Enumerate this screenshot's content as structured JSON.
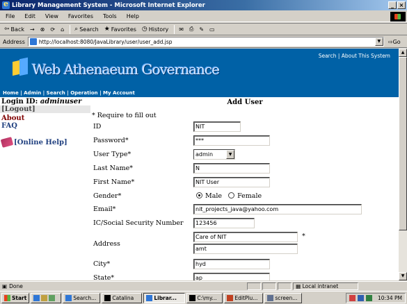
{
  "window": {
    "title": "Library Management System - Microsoft Internet Explorer",
    "controls": [
      "_",
      "×"
    ]
  },
  "menu": [
    "File",
    "Edit",
    "View",
    "Favorites",
    "Tools",
    "Help"
  ],
  "toolbar": {
    "back": "Back",
    "forward": "→",
    "search": "Search",
    "favorites": "Favorites",
    "history": "History"
  },
  "address": {
    "label": "Address",
    "url": "http://localhost:8080/JavaLibrary/user/user_add.jsp",
    "go": "Go"
  },
  "banner": {
    "brand": "Web Athenaeum Governance",
    "top_links": "Search | About This System"
  },
  "nav": "Home | Admin | Search | Operation | My Account",
  "sidebar": {
    "login_label": "Login ID: ",
    "login_user": "adminuser",
    "logout": "[Logout]",
    "about": "About",
    "faq": "FAQ",
    "help": "[Online Help]"
  },
  "form": {
    "title": "Add User",
    "required_note": "* Require to fill out",
    "id_label": "ID",
    "id_value": "NIT",
    "password_label": "Password*",
    "password_value": "***",
    "usertype_label": "User Type*",
    "usertype_value": "admin",
    "lastname_label": "Last Name*",
    "lastname_value": "N",
    "firstname_label": "First Name*",
    "firstname_value": "NIT User",
    "gender_label": "Gender*",
    "gender_male": "Male",
    "gender_female": "Female",
    "gender_selected": "Male",
    "email_label": "Email*",
    "email_value": "nit_projects_java@yahoo.com",
    "ic_label": "IC/Social Security Number",
    "ic_value": "123456",
    "address_label": "Address",
    "address_line1": "Care of NIT",
    "address_line2": "amt",
    "address_star": "*",
    "city_label": "City*",
    "city_value": "hyd",
    "state_label": "State*",
    "state_value": "ap"
  },
  "status": {
    "text": "Done",
    "zone": "Local intranet"
  },
  "taskbar": {
    "start": "Start",
    "buttons": [
      "Search...",
      "Catalina",
      "Librar...",
      "C:\\my...",
      "EditPlu...",
      "screen..."
    ],
    "time": "10:34 PM"
  },
  "colors": {
    "banner": "#0061a6",
    "title_bar": "#0a246a",
    "about": "#800000",
    "links": "#1f3f7f"
  }
}
